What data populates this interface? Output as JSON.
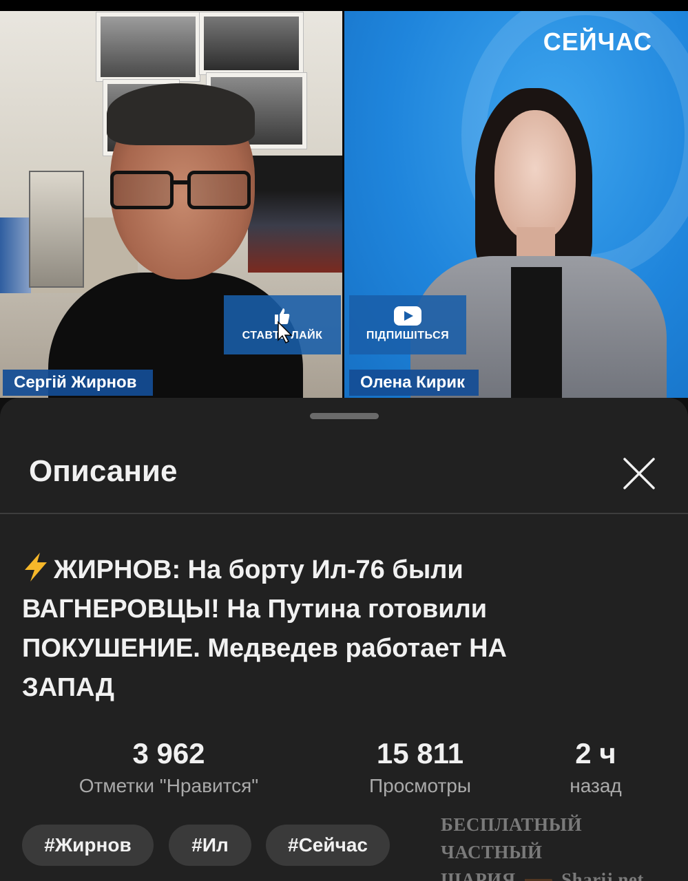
{
  "video": {
    "channel_logo": "СЕЙЧАС",
    "cta_like_label": "СТАВТЕ ЛАЙК",
    "cta_like_icon": "thumbs-up-icon",
    "cta_subscribe_label": "ПІДПИШІТЬСЯ",
    "cta_subscribe_icon": "youtube-play-icon",
    "guest_name": "Сергій Жирнов",
    "host_name": "Олена Кирик"
  },
  "sheet": {
    "title": "Описание",
    "close_icon": "close-icon"
  },
  "description": {
    "title_icon": "lightning-icon",
    "title": "ЖИРНОВ: На борту Ил-76 были ВАГНЕРОВЦЫ! На Путина готовили ПОКУШЕНИЕ. Медведев работает НА ЗАПАД"
  },
  "stats": {
    "likes_value": "3 962",
    "likes_label": "Отметки \"Нравится\"",
    "views_value": "15 811",
    "views_label": "Просмотры",
    "age_value": "2 ч",
    "age_label": "назад"
  },
  "tags": [
    "#Жирнов",
    "#Ил",
    "#Сейчас"
  ],
  "watermark": {
    "line1": "БЕСПЛАТНЫЙ ЧАСТНЫЙ",
    "line2_left": "ШАРИЯ",
    "line2_right": "Sharij.net"
  },
  "colors": {
    "sheet_bg": "#212121",
    "chip_bg": "#3a3a3a",
    "overlay_blue": "#195faa",
    "studio_blue": "#1f85dc",
    "bolt_yellow": "#f6b72a"
  }
}
